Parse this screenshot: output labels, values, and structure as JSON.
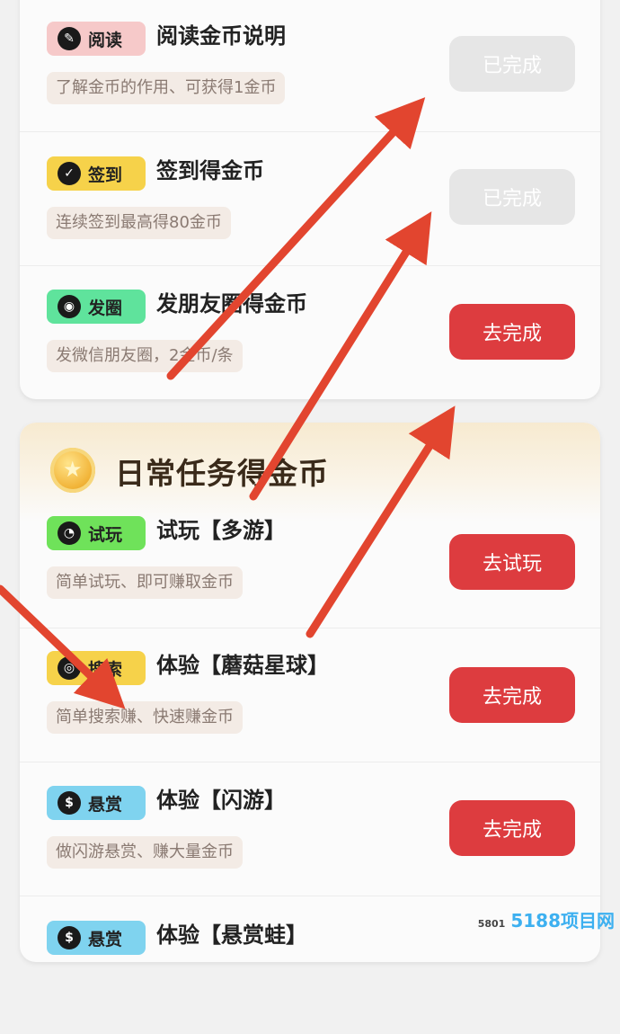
{
  "top_tasks": [
    {
      "tag": "阅读",
      "icon": "book-icon",
      "title": "阅读金币说明",
      "desc": "了解金币的作用、可获得1金币",
      "button": "已完成",
      "state": "done",
      "tag_color": "#f6c9c9"
    },
    {
      "tag": "签到",
      "icon": "calendar-check-icon",
      "title": "签到得金币",
      "desc": "连续签到最高得80金币",
      "button": "已完成",
      "state": "done",
      "tag_color": "#f6d24a"
    },
    {
      "tag": "发圈",
      "icon": "camera-aperture-icon",
      "title": "发朋友圈得金币",
      "desc": "发微信朋友圈，2金币/条",
      "button": "去完成",
      "state": "todo",
      "tag_color": "#5fe39c"
    }
  ],
  "daily": {
    "title": "日常任务得金币",
    "tasks": [
      {
        "tag": "试玩",
        "icon": "pacman-icon",
        "title": "试玩【多游】",
        "desc": "简单试玩、即可赚取金币",
        "button": "去试玩",
        "tag_color": "#6fe25a"
      },
      {
        "tag": "搜索",
        "icon": "search-icon",
        "title": "体验【蘑菇星球】",
        "desc": "简单搜索赚、快速赚金币",
        "button": "去完成",
        "tag_color": "#f6d24a"
      },
      {
        "tag": "悬赏",
        "icon": "money-bag-icon",
        "title": "体验【闪游】",
        "desc": "做闪游悬赏、赚大量金币",
        "button": "去完成",
        "tag_color": "#7fd3ef"
      },
      {
        "tag": "悬赏",
        "icon": "money-bag-icon",
        "title": "体验【悬赏蛙】",
        "desc": "",
        "button": "",
        "tag_color": "#7fd3ef"
      }
    ]
  },
  "watermark": {
    "prefix": "5801",
    "text": "5188项目网"
  },
  "colors": {
    "accent_red": "#dd3c3f",
    "done_gray": "#e6e6e6",
    "arrow_red": "#e2452f"
  }
}
